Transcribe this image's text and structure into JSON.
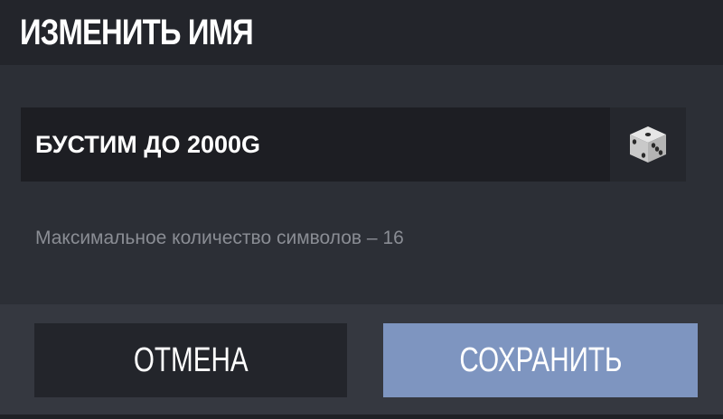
{
  "dialog": {
    "title": "ИЗМЕНИТЬ ИМЯ",
    "name_input": {
      "value": "БУСТИМ ДО 2000G",
      "placeholder": ""
    },
    "random_icon": "dice-icon",
    "hint": "Максимальное количество символов – 16",
    "buttons": {
      "cancel_label": "ОТМЕНА",
      "save_label": "СОХРАНИТЬ"
    }
  },
  "colors": {
    "header_bg": "#23252b",
    "body_bg": "#2c2f36",
    "input_bg": "#1d1e23",
    "footer_bg": "#353840",
    "cancel_bg": "#23252b",
    "save_bg": "#7e95c0",
    "hint_text": "#8a8d94"
  }
}
